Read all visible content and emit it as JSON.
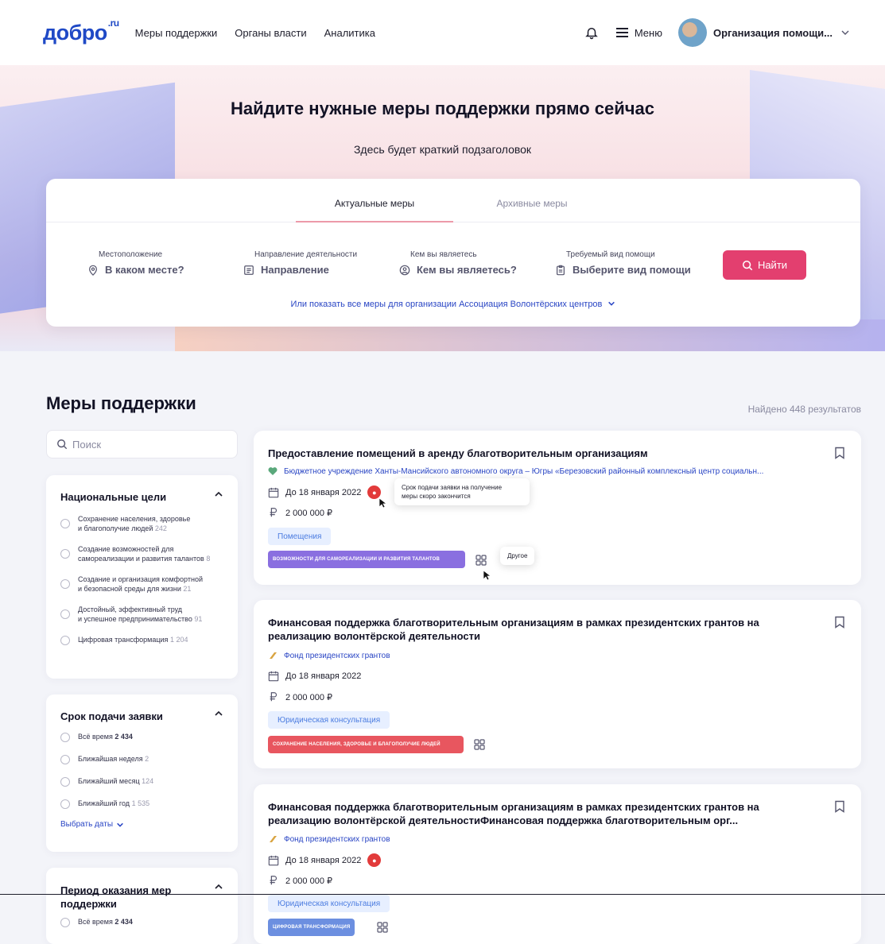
{
  "header": {
    "logo_main": "добро",
    "logo_suffix": ".ru",
    "nav": [
      "Меры поддержки",
      "Органы власти",
      "Аналитика"
    ],
    "menu_label": "Меню",
    "org_name": "Организация помощи..."
  },
  "hero": {
    "title": "Найдите нужные меры поддержки прямо сейчас",
    "subtitle": "Здесь будет краткий подзаголовок"
  },
  "search": {
    "tabs": [
      "Актуальные меры",
      "Архивные меры"
    ],
    "filters": [
      {
        "label": "Местоположение",
        "value": "В каком месте?",
        "icon": "location-icon"
      },
      {
        "label": "Направление деятельности",
        "value": "Направление",
        "icon": "list-icon"
      },
      {
        "label": "Кем вы являетесь",
        "value": "Кем вы являетесь?",
        "icon": "person-icon"
      },
      {
        "label": "Требуемый вид помощи",
        "value": "Выберите вид помощи",
        "icon": "clipboard-icon"
      }
    ],
    "find_label": "Найти",
    "show_all": "Или показать все меры для организации Ассоциация Волонтёрских центров"
  },
  "section": {
    "title": "Меры поддержки",
    "results": "Найдено 448 результатов",
    "search_placeholder": "Поиск"
  },
  "sidebar": {
    "national_goals": {
      "title": "Национальные цели",
      "options": [
        {
          "line1": "Сохранение населения, здоровье",
          "line2": "и благополучие людей",
          "count": "242"
        },
        {
          "line1": "Создание возможностей для",
          "line2": "самореализации и развития талантов",
          "count": "8"
        },
        {
          "line1": "Создание и организация комфортной",
          "line2": "и безопасной среды для жизни",
          "count": "21"
        },
        {
          "line1": "Достойный, эффективный труд",
          "line2": "и успешное предпринимательство",
          "count": "91"
        },
        {
          "line1": "Цифровая трансформация",
          "line2": "",
          "count": "1 204"
        }
      ]
    },
    "deadline": {
      "title": "Срок подачи заявки",
      "options": [
        {
          "label": "Всё время",
          "count": "2 434",
          "bold": true
        },
        {
          "label": "Ближайшая неделя",
          "count": "2"
        },
        {
          "label": "Ближайший месяц",
          "count": "124"
        },
        {
          "label": "Ближайший год",
          "count": "1 535"
        }
      ],
      "pick_dates": "Выбрать даты"
    },
    "period": {
      "title_line1": "Период оказания мер",
      "title_line2": "поддержки",
      "options": [
        {
          "label": "Всё время",
          "count": "2 434"
        }
      ]
    }
  },
  "cards": [
    {
      "title": "Предоставление помещений в аренду благотворительным организациям",
      "org": "Бюджетное учреждение Ханты-Мансийского автономного округа – Югры «Березовский районный комплексный центр социальн...",
      "deadline": "До 18 января 2022",
      "amount": "2 000 000 ₽",
      "tag": "Помещения",
      "goal": "ВОЗМОЖНОСТИ ДЛЯ САМОРЕАЛИЗАЦИИ И РАЗВИТИЯ ТАЛАНТОВ",
      "goal_color": "#8a6fe0",
      "tooltip_deadline_1": "Срок подачи заявки на получение",
      "tooltip_deadline_2": "меры скоро закончится",
      "tooltip_other": "Другое"
    },
    {
      "title_line1": "Финансовая поддержка благотворительным организациям в рамках президентских грантов на",
      "title_line2": "реализацию волонтёрской деятельности",
      "org": "Фонд президентских грантов",
      "deadline": "До 18 января 2022",
      "amount": "2 000 000 ₽",
      "tag": "Юридическая консультация",
      "goal": "СОХРАНЕНИЕ НАСЕЛЕНИЯ, ЗДОРОВЬЕ И БЛАГОПОЛУЧИЕ ЛЮДЕЙ",
      "goal_color": "#e8565f"
    },
    {
      "title_line1": "Финансовая поддержка благотворительным организациям в рамках президентских грантов на",
      "title_line2": "реализацию волонтёрской деятельностиФинансовая поддержка благотворительным орг...",
      "org": "Фонд президентских грантов",
      "deadline": "До 18 января 2022",
      "amount": "2 000 000 ₽",
      "tag": "Юридическая консультация",
      "goal": "ЦИФРОВАЯ ТРАНСФОРМАЦИЯ",
      "goal_color": "#6c8fe0"
    }
  ]
}
